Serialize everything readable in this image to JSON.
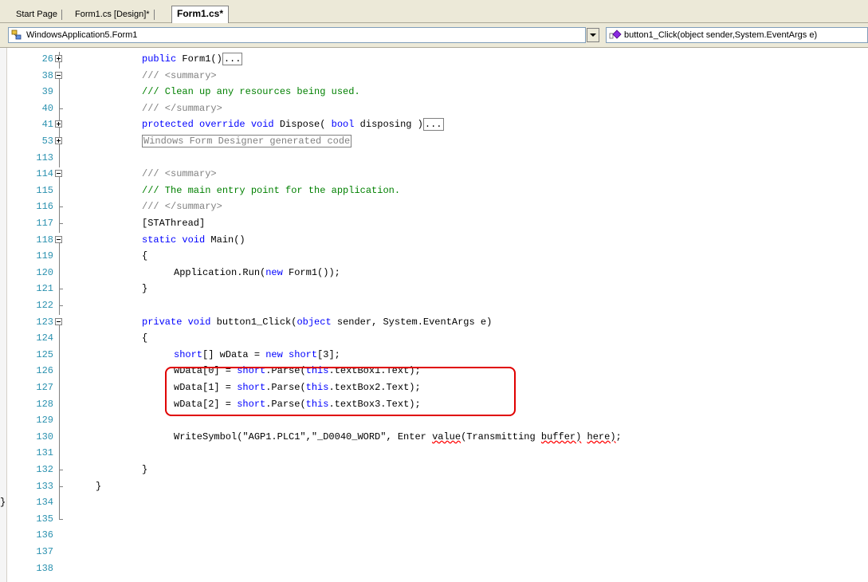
{
  "tabs": [
    {
      "label": "Start Page",
      "active": false
    },
    {
      "label": "Form1.cs [Design]*",
      "active": false
    },
    {
      "label": "Form1.cs*",
      "active": true
    }
  ],
  "nav": {
    "class_combo": "WindowsApplication5.Form1",
    "member_combo": "button1_Click(object sender,System.EventArgs e)"
  },
  "lines": [
    {
      "num": "26",
      "fold": "plus",
      "indent": 2,
      "tokens": [
        [
          "kw",
          "public"
        ],
        [
          "t",
          " Form1()"
        ],
        [
          "box",
          "..."
        ]
      ]
    },
    {
      "num": "38",
      "fold": "minus",
      "indent": 2,
      "tokens": [
        [
          "cmx",
          "/// <summary>"
        ]
      ]
    },
    {
      "num": "39",
      "fold": "line",
      "indent": 2,
      "tokens": [
        [
          "cm",
          "/// Clean up any resources being used."
        ]
      ]
    },
    {
      "num": "40",
      "fold": "end",
      "indent": 2,
      "tokens": [
        [
          "cmx",
          "/// </summary>"
        ]
      ]
    },
    {
      "num": "41",
      "fold": "plus",
      "indent": 2,
      "tokens": [
        [
          "kw",
          "protected override void"
        ],
        [
          "t",
          " Dispose( "
        ],
        [
          "kw",
          "bool"
        ],
        [
          "t",
          " disposing )"
        ],
        [
          "box",
          "..."
        ]
      ]
    },
    {
      "num": "53",
      "fold": "plus",
      "indent": 2,
      "tokens": [
        [
          "boxg",
          "Windows Form Designer generated code"
        ]
      ]
    },
    {
      "num": "113",
      "fold": "line",
      "indent": 2,
      "tokens": []
    },
    {
      "num": "114",
      "fold": "minus",
      "indent": 2,
      "tokens": [
        [
          "cmx",
          "/// <summary>"
        ]
      ]
    },
    {
      "num": "115",
      "fold": "line",
      "indent": 2,
      "tokens": [
        [
          "cm",
          "/// The main entry point for the application."
        ]
      ]
    },
    {
      "num": "116",
      "fold": "end",
      "indent": 2,
      "tokens": [
        [
          "cmx",
          "/// </summary>"
        ]
      ]
    },
    {
      "num": "117",
      "fold": "end",
      "indent": 2,
      "tokens": [
        [
          "t",
          "[STAThread]"
        ]
      ]
    },
    {
      "num": "118",
      "fold": "minus",
      "indent": 2,
      "tokens": [
        [
          "kw",
          "static void"
        ],
        [
          "t",
          " Main()"
        ]
      ]
    },
    {
      "num": "119",
      "fold": "line",
      "indent": 2,
      "tokens": [
        [
          "t",
          "{"
        ]
      ]
    },
    {
      "num": "120",
      "fold": "line",
      "indent": 3,
      "tokens": [
        [
          "t",
          "Application.Run("
        ],
        [
          "kw",
          "new"
        ],
        [
          "t",
          " Form1());"
        ]
      ]
    },
    {
      "num": "121",
      "fold": "end",
      "indent": 2,
      "tokens": [
        [
          "t",
          "}"
        ]
      ]
    },
    {
      "num": "122",
      "fold": "end",
      "indent": 2,
      "tokens": []
    },
    {
      "num": "123",
      "fold": "minus",
      "indent": 2,
      "tokens": [
        [
          "kw",
          "private void"
        ],
        [
          "t",
          " button1_Click("
        ],
        [
          "kw",
          "object"
        ],
        [
          "t",
          " sender, System.EventArgs e)"
        ]
      ]
    },
    {
      "num": "124",
      "fold": "line",
      "indent": 2,
      "tokens": [
        [
          "t",
          "{"
        ]
      ]
    },
    {
      "num": "125",
      "fold": "line",
      "indent": 3,
      "tokens": [
        [
          "kw",
          "short"
        ],
        [
          "t",
          "[] wData = "
        ],
        [
          "kw",
          "new short"
        ],
        [
          "t",
          "[3];"
        ]
      ]
    },
    {
      "num": "126",
      "fold": "line",
      "indent": 3,
      "tokens": [
        [
          "t",
          "wData[0] = "
        ],
        [
          "kw",
          "short"
        ],
        [
          "t",
          ".Parse("
        ],
        [
          "kw",
          "this"
        ],
        [
          "t",
          ".textBox1.Text);"
        ]
      ]
    },
    {
      "num": "127",
      "fold": "line",
      "indent": 3,
      "tokens": [
        [
          "t",
          "wData[1] = "
        ],
        [
          "kw",
          "short"
        ],
        [
          "t",
          ".Parse("
        ],
        [
          "kw",
          "this"
        ],
        [
          "t",
          ".textBox2.Text);"
        ]
      ]
    },
    {
      "num": "128",
      "fold": "line",
      "indent": 3,
      "tokens": [
        [
          "t",
          "wData[2] = "
        ],
        [
          "kw",
          "short"
        ],
        [
          "t",
          ".Parse("
        ],
        [
          "kw",
          "this"
        ],
        [
          "t",
          ".textBox3.Text);"
        ]
      ]
    },
    {
      "num": "129",
      "fold": "line",
      "indent": 2,
      "tokens": []
    },
    {
      "num": "130",
      "fold": "line",
      "indent": 3,
      "tokens": [
        [
          "t",
          "WriteSymbol(\"AGP1.PLC1\",\"_D0040_WORD\", Enter "
        ],
        [
          "sq",
          "value"
        ],
        [
          "t",
          "(Transmitting "
        ],
        [
          "sq",
          "buffer)"
        ],
        [
          "t",
          " "
        ],
        [
          "sq",
          "here)"
        ],
        [
          "t",
          ";"
        ]
      ]
    },
    {
      "num": "131",
      "fold": "line",
      "indent": 2,
      "tokens": []
    },
    {
      "num": "132",
      "fold": "end",
      "indent": 2,
      "tokens": [
        [
          "t",
          "}"
        ]
      ]
    },
    {
      "num": "133",
      "fold": "end",
      "indent": 1,
      "tokens": [
        [
          "t",
          "}"
        ]
      ]
    },
    {
      "num": "134",
      "fold": "line",
      "indent": 0,
      "tokens": [
        [
          "t",
          "}"
        ]
      ]
    },
    {
      "num": "135",
      "fold": "last",
      "indent": 0,
      "tokens": []
    },
    {
      "num": "136",
      "fold": "none",
      "indent": 0,
      "tokens": []
    },
    {
      "num": "137",
      "fold": "none",
      "indent": 0,
      "tokens": []
    },
    {
      "num": "138",
      "fold": "none",
      "indent": 0,
      "tokens": []
    }
  ],
  "colors": {
    "keyword": "#0000ff",
    "comment": "#008000",
    "line_number": "#2b91af",
    "highlight_box": "#e00000"
  },
  "icons": {
    "class_combo": "class-icon",
    "member_combo": "method-icon"
  }
}
